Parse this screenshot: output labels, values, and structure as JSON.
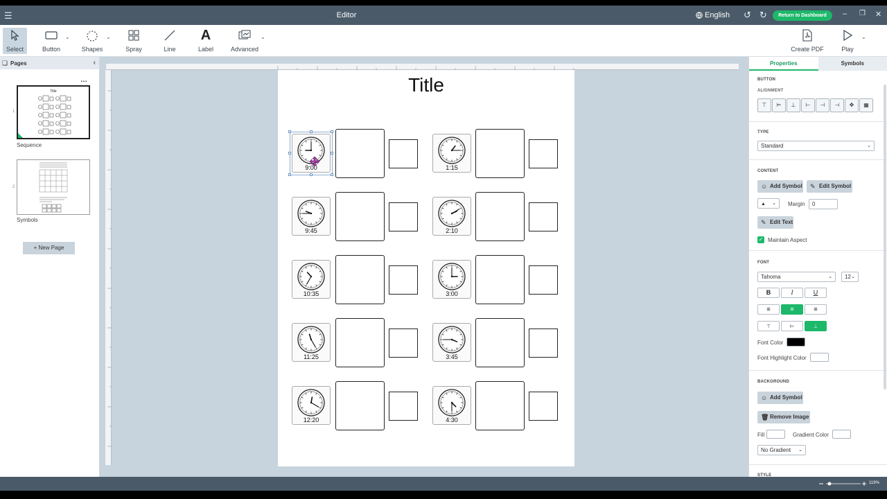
{
  "titlebar": {
    "title": "Editor",
    "language": "English",
    "return_label": "Return to Dashboard"
  },
  "toolbar": {
    "tools": [
      {
        "label": "Select",
        "icon": "cursor-icon"
      },
      {
        "label": "Button",
        "icon": "button-icon"
      },
      {
        "label": "Shapes",
        "icon": "shapes-icon"
      },
      {
        "label": "Spray",
        "icon": "spray-icon"
      },
      {
        "label": "Line",
        "icon": "line-icon"
      },
      {
        "label": "Label",
        "icon": "label-icon"
      },
      {
        "label": "Advanced",
        "icon": "advanced-icon"
      }
    ],
    "create_pdf": "Create PDF",
    "play": "Play"
  },
  "pages_panel": {
    "header": "Pages",
    "pages": [
      {
        "number": "1",
        "label": "Sequence"
      },
      {
        "number": "2",
        "label": "Symbols"
      }
    ],
    "new_page": "+ New Page"
  },
  "document": {
    "title": "Title",
    "left_times": [
      "9:00",
      "9:45",
      "10:35",
      "11:25",
      "12:20"
    ],
    "right_times": [
      "1:15",
      "2:10",
      "3:00",
      "3:45",
      "4:30"
    ]
  },
  "properties": {
    "tabs": [
      "Properties",
      "Symbols"
    ],
    "section_button": "BUTTON",
    "section_alignment": "ALIGNMENT",
    "section_type": "TYPE",
    "type_value": "Standard",
    "section_content": "CONTENT",
    "add_symbol": "Add Symbol",
    "edit_symbol": "Edit Symbol",
    "margin_label": "Margin",
    "margin_value": "0",
    "edit_text": "Edit Text",
    "maintain_aspect": "Maintain Aspect",
    "section_font": "FONT",
    "font_family": "Tahoma",
    "font_size": "12",
    "bold": "B",
    "italic": "I",
    "underline": "U",
    "font_color_label": "Font Color",
    "font_highlight_label": "Font Highlight Color",
    "section_background": "BACKGROUND",
    "bg_add_symbol": "Add Symbol",
    "remove_image": "Remove Image",
    "fill_label": "Fill",
    "gradient_color_label": "Gradient Color",
    "gradient_value": "No Gradient",
    "section_style": "STYLE",
    "colors": {
      "font_color": "#000000",
      "accent": "#1db86a"
    }
  },
  "status": {
    "zoom": "119%"
  }
}
